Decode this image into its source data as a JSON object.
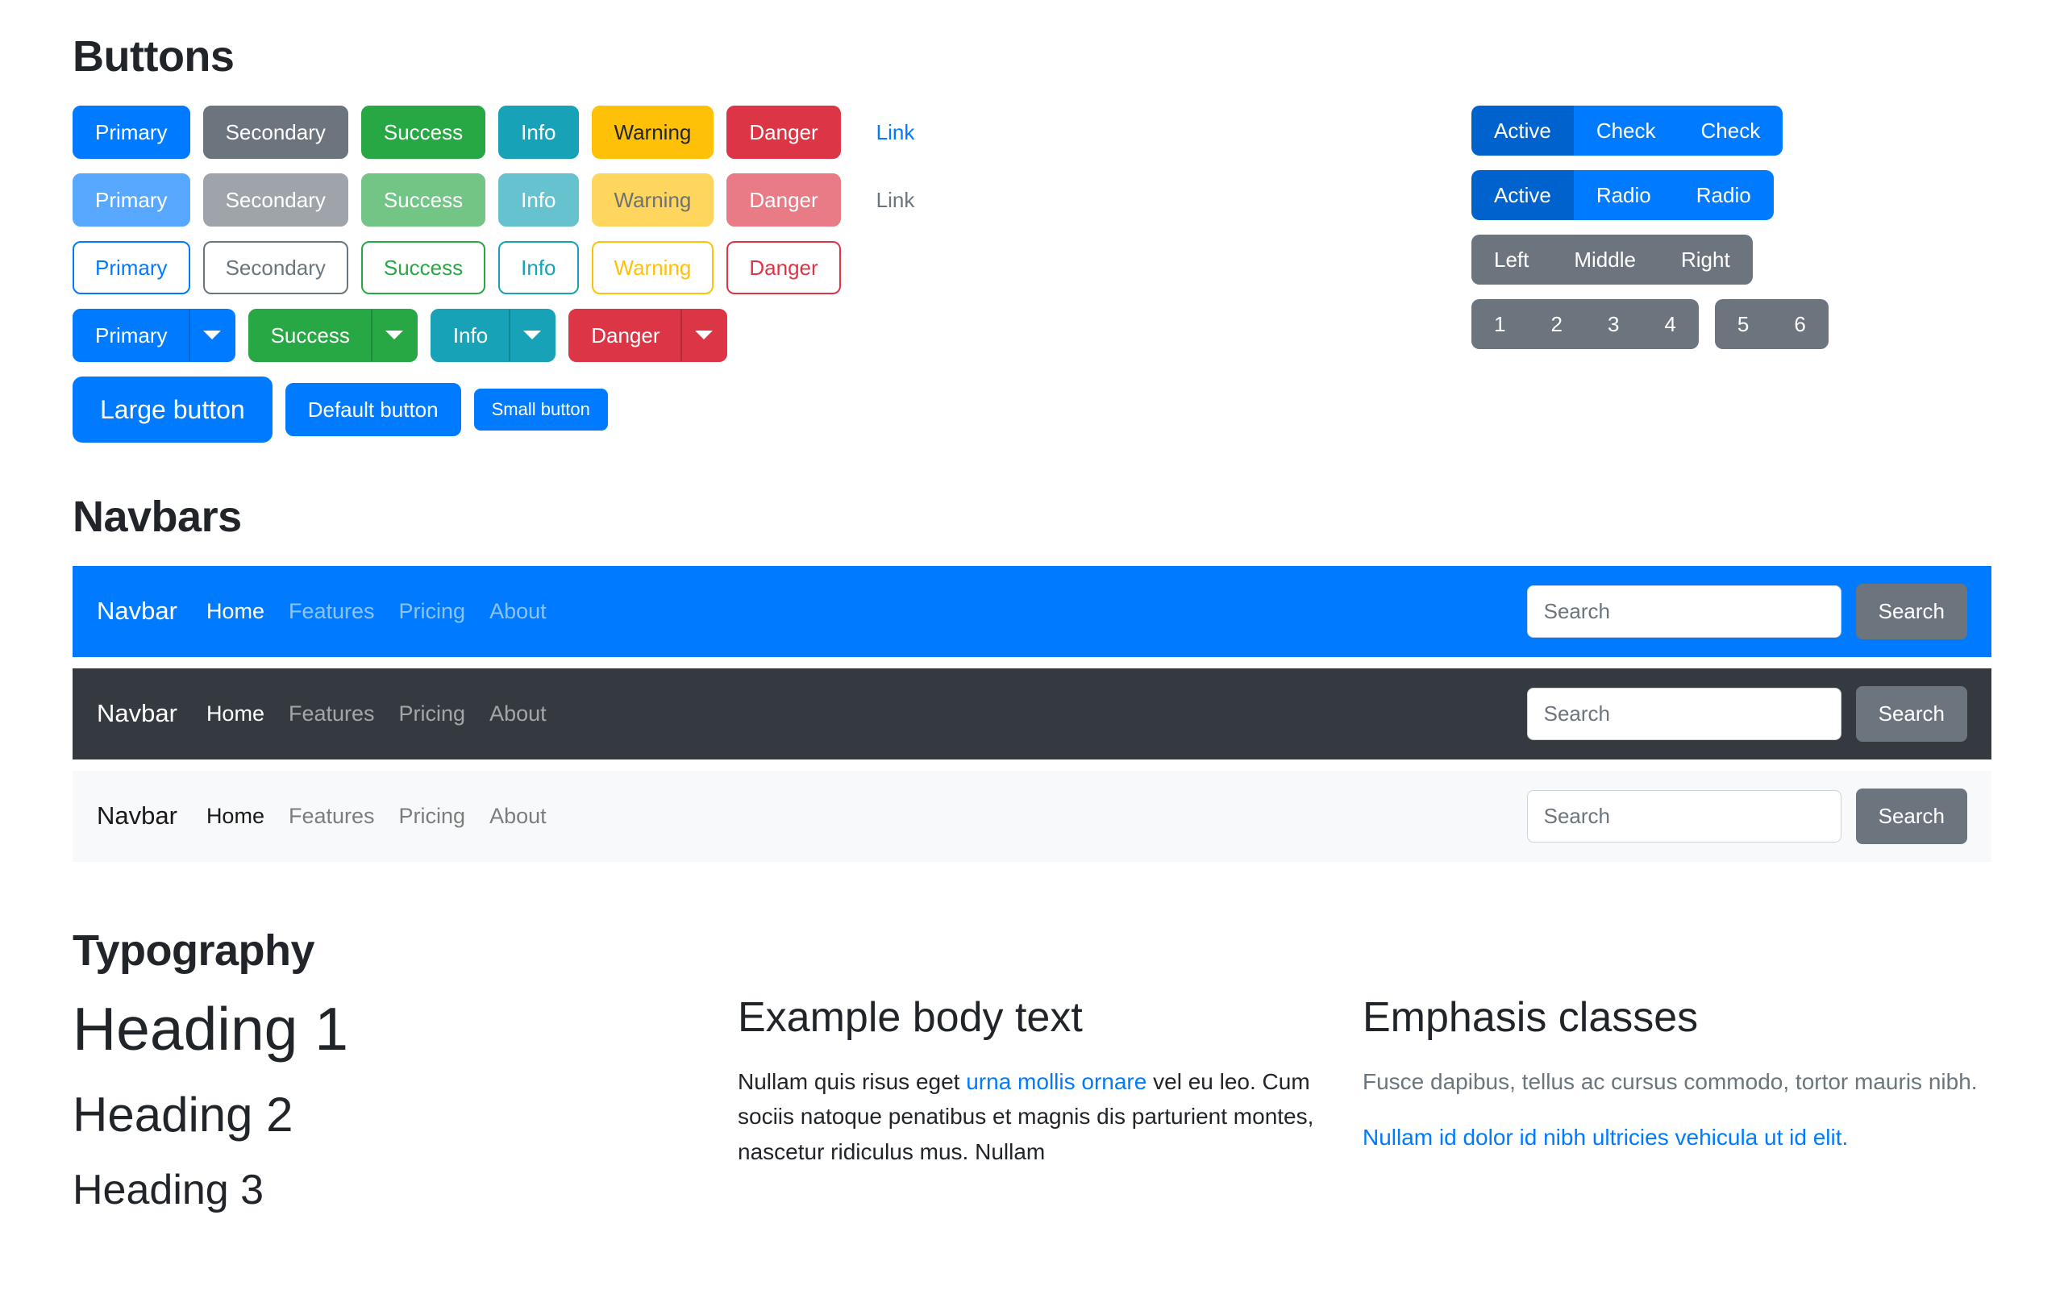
{
  "sections": {
    "buttons_title": "Buttons",
    "navbars_title": "Navbars",
    "typography_title": "Typography"
  },
  "buttons": {
    "solid_row": [
      {
        "label": "Primary",
        "variant": "primary"
      },
      {
        "label": "Secondary",
        "variant": "secondary"
      },
      {
        "label": "Success",
        "variant": "success"
      },
      {
        "label": "Info",
        "variant": "info"
      },
      {
        "label": "Warning",
        "variant": "warning"
      },
      {
        "label": "Danger",
        "variant": "danger"
      },
      {
        "label": "Link",
        "variant": "link"
      }
    ],
    "disabled_row": [
      {
        "label": "Primary",
        "variant": "primary"
      },
      {
        "label": "Secondary",
        "variant": "secondary"
      },
      {
        "label": "Success",
        "variant": "success"
      },
      {
        "label": "Info",
        "variant": "info"
      },
      {
        "label": "Warning",
        "variant": "warning"
      },
      {
        "label": "Danger",
        "variant": "danger"
      },
      {
        "label": "Link",
        "variant": "link"
      }
    ],
    "outline_row": [
      {
        "label": "Primary",
        "variant": "primary"
      },
      {
        "label": "Secondary",
        "variant": "secondary"
      },
      {
        "label": "Success",
        "variant": "success"
      },
      {
        "label": "Info",
        "variant": "info"
      },
      {
        "label": "Warning",
        "variant": "warning"
      },
      {
        "label": "Danger",
        "variant": "danger"
      }
    ],
    "dropdown_row": [
      {
        "label": "Primary",
        "variant": "primary",
        "icon": "caret-down-icon"
      },
      {
        "label": "Success",
        "variant": "success",
        "icon": "caret-down-icon"
      },
      {
        "label": "Info",
        "variant": "info",
        "icon": "caret-down-icon"
      },
      {
        "label": "Danger",
        "variant": "danger",
        "icon": "caret-down-icon"
      }
    ],
    "sizes_row": [
      {
        "label": "Large button",
        "size": "lg"
      },
      {
        "label": "Default button",
        "size": "md"
      },
      {
        "label": "Small button",
        "size": "sm"
      }
    ]
  },
  "button_groups": {
    "checkbox_group": {
      "items": [
        "Active",
        "Check",
        "Check"
      ],
      "active_index": 0
    },
    "radio_group": {
      "items": [
        "Active",
        "Radio",
        "Radio"
      ],
      "active_index": 0
    },
    "position_group": {
      "items": [
        "Left",
        "Middle",
        "Right"
      ]
    },
    "number_group_a": {
      "items": [
        "1",
        "2",
        "3",
        "4"
      ]
    },
    "number_group_b": {
      "items": [
        "5",
        "6"
      ]
    }
  },
  "navbars": [
    {
      "theme": "primary",
      "brand": "Navbar",
      "links": [
        {
          "label": "Home",
          "active": true
        },
        {
          "label": "Features",
          "active": false
        },
        {
          "label": "Pricing",
          "active": false
        },
        {
          "label": "About",
          "active": false
        }
      ],
      "search_placeholder": "Search",
      "search_value": "",
      "search_button": "Search"
    },
    {
      "theme": "dark",
      "brand": "Navbar",
      "links": [
        {
          "label": "Home",
          "active": true
        },
        {
          "label": "Features",
          "active": false
        },
        {
          "label": "Pricing",
          "active": false
        },
        {
          "label": "About",
          "active": false
        }
      ],
      "search_placeholder": "Search",
      "search_value": "",
      "search_button": "Search"
    },
    {
      "theme": "light",
      "brand": "Navbar",
      "links": [
        {
          "label": "Home",
          "active": true
        },
        {
          "label": "Features",
          "active": false
        },
        {
          "label": "Pricing",
          "active": false
        },
        {
          "label": "About",
          "active": false
        }
      ],
      "search_placeholder": "Search",
      "search_value": "",
      "search_button": "Search"
    }
  ],
  "typography": {
    "headings": [
      "Heading 1",
      "Heading 2",
      "Heading 3"
    ],
    "body": {
      "heading": "Example body text",
      "text_before": "Nullam quis risus eget ",
      "link": "urna mollis ornare",
      "text_after": " vel eu leo. Cum sociis natoque penatibus et magnis dis parturient montes, nascetur ridiculus mus. Nullam"
    },
    "emphasis": {
      "heading": "Emphasis classes",
      "muted": "Fusce dapibus, tellus ac cursus commodo, tortor mauris nibh.",
      "primary": "Nullam id dolor id nibh ultricies vehicula ut id elit."
    }
  },
  "colors": {
    "primary": "#007bff",
    "secondary": "#6c757d",
    "success": "#28a745",
    "info": "#17a2b8",
    "warning": "#ffc107",
    "danger": "#dc3545",
    "dark": "#343a40",
    "light": "#f8f9fa",
    "active_blue": "#0062cc",
    "body": "#212529",
    "muted": "#6c757d"
  }
}
